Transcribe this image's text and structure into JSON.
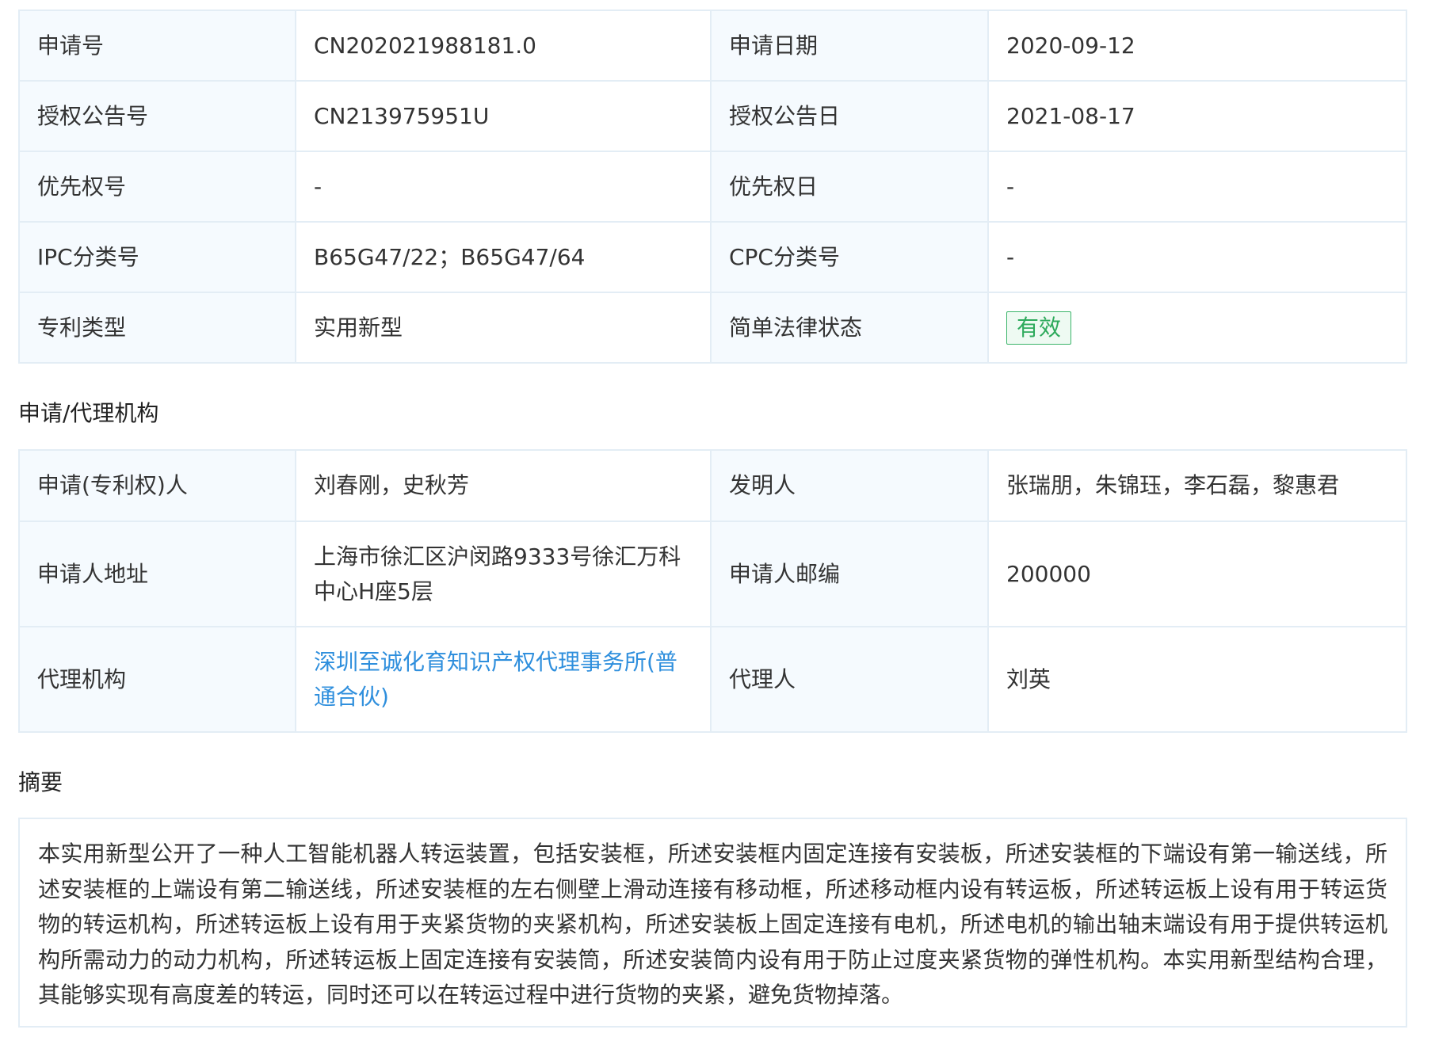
{
  "basic_info": [
    {
      "label1": "申请号",
      "value1": "CN202021988181.0",
      "label2": "申请日期",
      "value2": "2020-09-12"
    },
    {
      "label1": "授权公告号",
      "value1": "CN213975951U",
      "label2": "授权公告日",
      "value2": "2021-08-17"
    },
    {
      "label1": "优先权号",
      "value1": "-",
      "label2": "优先权日",
      "value2": "-"
    },
    {
      "label1": "IPC分类号",
      "value1": "B65G47/22；B65G47/64",
      "label2": "CPC分类号",
      "value2": "-"
    },
    {
      "label1": "专利类型",
      "value1": "实用新型",
      "label2": "简单法律状态",
      "value2": "有效"
    }
  ],
  "section_agency": {
    "title": "申请/代理机构"
  },
  "applicant_info": [
    {
      "label1": "申请(专利权)人",
      "value1": "刘春刚，史秋芳",
      "label2": "发明人",
      "value2": "张瑞朋，朱锦珏，李石磊，黎惠君"
    },
    {
      "label1": "申请人地址",
      "value1": "上海市徐汇区沪闵路9333号徐汇万科中心H座5层",
      "label2": "申请人邮编",
      "value2": "200000"
    },
    {
      "label1": "代理机构",
      "value1": "深圳至诚化育知识产权代理事务所(普通合伙)",
      "label2": "代理人",
      "value2": "刘英"
    }
  ],
  "section_abstract": {
    "title": "摘要",
    "text": "本实用新型公开了一种人工智能机器人转运装置，包括安装框，所述安装框内固定连接有安装板，所述安装框的下端设有第一输送线，所述安装框的上端设有第二输送线，所述安装框的左右侧壁上滑动连接有移动框，所述移动框内设有转运板，所述转运板上设有用于转运货物的转运机构，所述转运板上设有用于夹紧货物的夹紧机构，所述安装板上固定连接有电机，所述电机的输出轴末端设有用于提供转运机构所需动力的动力机构，所述转运板上固定连接有安装筒，所述安装筒内设有用于防止过度夹紧货物的弹性机构。本实用新型结构合理，其能够实现有高度差的转运，同时还可以在转运过程中进行货物的夹紧，避免货物掉落。"
  },
  "colors": {
    "link": "#2f8fdd",
    "status_valid": "#2eaa5c",
    "label_bg": "#f5fafe",
    "border": "#e3edf5"
  }
}
